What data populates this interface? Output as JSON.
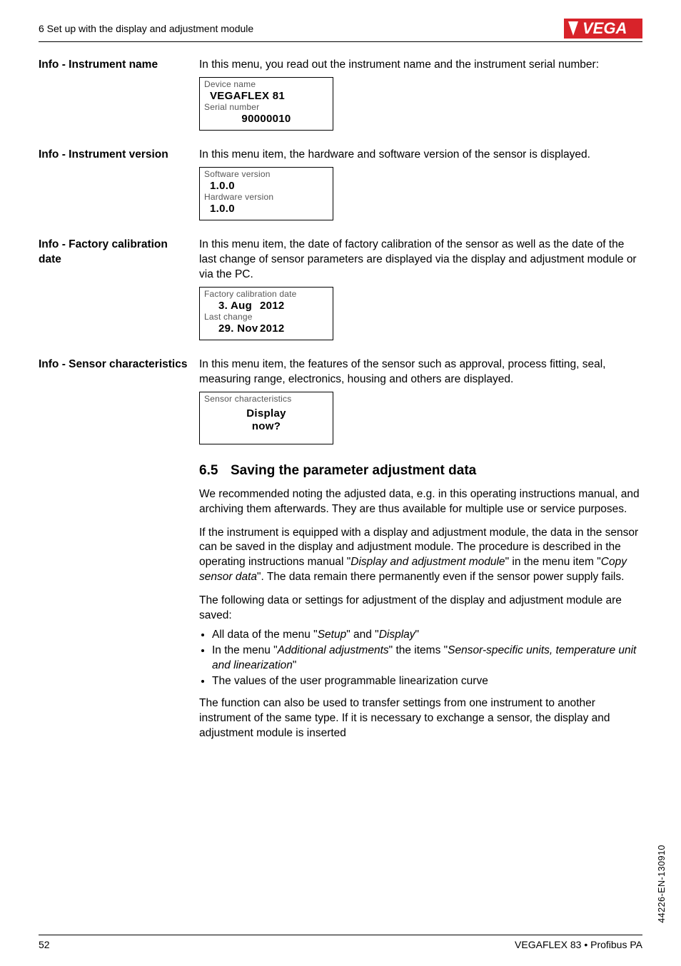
{
  "header": {
    "left": "6 Set up with the display and adjustment module"
  },
  "sections": [
    {
      "label": "Info - Instrument name",
      "para": "In this menu, you read out the instrument name and the instrument serial number:",
      "lcd": {
        "l1_label": "Device name",
        "l1_value": "VEGAFLEX 81",
        "l2_label": "Serial number",
        "l2_value": "90000010"
      }
    },
    {
      "label": "Info - Instrument version",
      "para": "In this menu item, the hardware and software version of the sensor is displayed.",
      "lcd": {
        "l1_label": "Software version",
        "l1_value": "1.0.0",
        "l2_label": "Hardware version",
        "l2_value": "1.0.0"
      }
    },
    {
      "label": "Info - Factory calibration date",
      "para": "In this menu item, the date of factory calibration of the sensor as well as the date of the last change of sensor parameters are displayed via the display and adjustment module or via the PC.",
      "lcd": {
        "l1_label": "Factory calibration date",
        "l1_a": "3. Aug",
        "l1_b": "2012",
        "l2_label": "Last change",
        "l2_a": "29. Nov",
        "l2_b": "2012"
      }
    },
    {
      "label": "Info - Sensor characteristics",
      "para": "In this menu item, the features of the sensor such as approval, process fitting, seal, measuring range, electronics, housing and others are displayed.",
      "lcd": {
        "l1_label": "Sensor characteristics",
        "c1": "Display",
        "c2": "now?"
      }
    }
  ],
  "saving": {
    "num": "6.5",
    "title": "Saving the parameter adjustment data",
    "p1": "We recommended noting the adjusted data, e.g. in this operating instructions manual, and archiving them afterwards. They are thus available for multiple use or service purposes.",
    "p2a": "If the instrument is equipped with a display and adjustment module, the data in the sensor can be saved in the display and adjustment module. The procedure is described in the operating instructions manual \"",
    "p2i1": "Display and adjustment module",
    "p2b": "\" in the menu item \"",
    "p2i2": "Copy sensor data",
    "p2c": "\". The data remain there permanently even if the sensor power supply fails.",
    "p3": "The following data or settings for adjustment of the display and adjustment module are saved:",
    "b1a": "All data of the menu \"",
    "b1i1": "Setup",
    "b1b": "\" and \"",
    "b1i2": "Display",
    "b1c": "\"",
    "b2a": "In the menu \"",
    "b2i1": "Additional adjustments",
    "b2b": "\" the items \"",
    "b2i2": "Sensor-specific units, temperature unit and linearization",
    "b2c": "\"",
    "b3": "The values of the user programmable linearization curve",
    "p4": "The function can also be used to transfer settings from one instrument to another instrument of the same type. If it is necessary to exchange a sensor, the display and adjustment module is inserted"
  },
  "footer": {
    "page": "52",
    "product": "VEGAFLEX 83 • Profibus PA"
  },
  "side": "44226-EN-130910"
}
